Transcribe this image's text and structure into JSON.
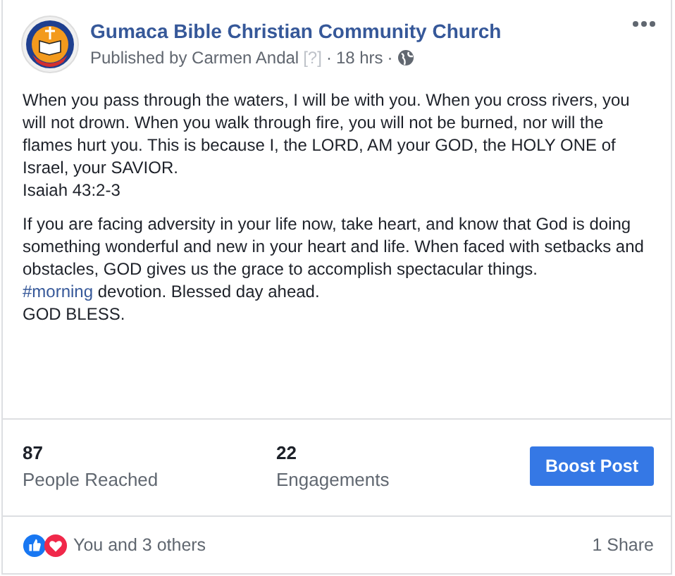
{
  "post": {
    "page_name": "Gumaca Bible Christian Community Church",
    "published_by": "Published by Carmen Andal",
    "help_mark": "[?]",
    "time": "18 hrs",
    "separator": "·"
  },
  "body": [
    [
      {
        "text": "When you pass through the waters, I will be with you. When you cross rivers, you will not drown. When you walk through fire, you will not be burned, nor will the flames hurt you. This is because I, the LORD, AM your GOD, the HOLY ONE of Israel, your SAVIOR."
      },
      {
        "text": "Isaiah 43:2-3"
      }
    ],
    [
      {
        "text": "If you are facing adversity in your life now, take heart, and know that God is doing something wonderful and new in your heart and life. When faced with setbacks and obstacles, GOD gives us the grace to accomplish spectacular things."
      },
      {
        "hashtag": "#morning",
        "text": " devotion. Blessed day ahead."
      },
      {
        "text": "GOD BLESS."
      }
    ]
  ],
  "stats": [
    {
      "value": "87",
      "label": "People Reached"
    },
    {
      "value": "22",
      "label": "Engagements"
    }
  ],
  "boost_button": "Boost Post",
  "reactions": {
    "text": "You and 3 others",
    "shares": "1 Share"
  }
}
